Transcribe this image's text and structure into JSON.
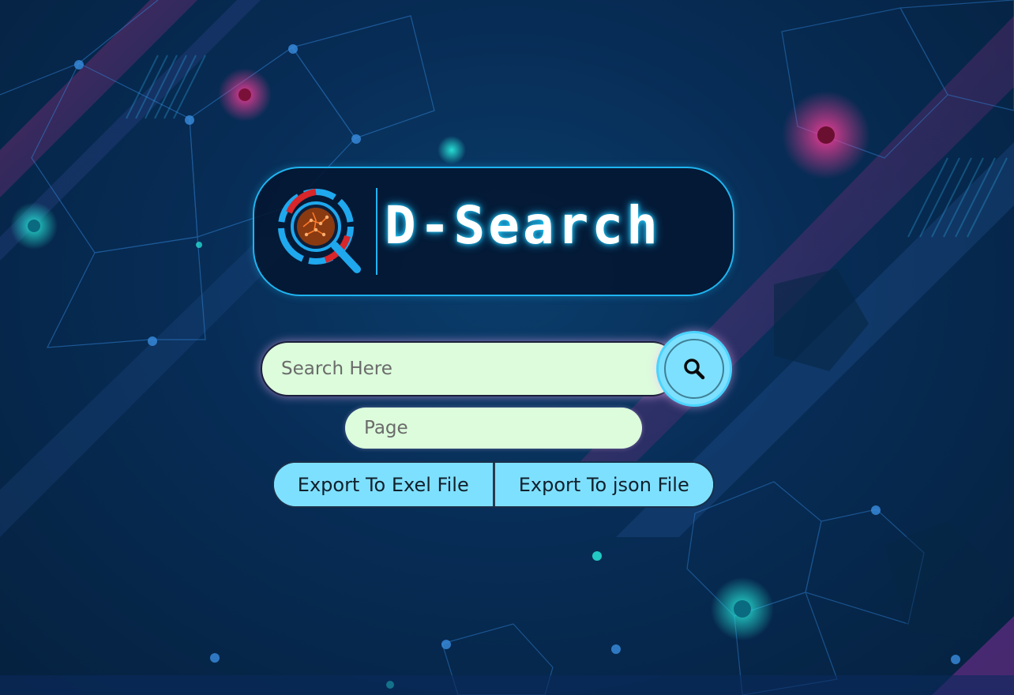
{
  "app": {
    "title": "D-Search"
  },
  "search": {
    "placeholder": "Search Here"
  },
  "page_field": {
    "placeholder": "Page"
  },
  "export": {
    "excel_label": "Export To Exel File",
    "json_label": "Export To json File"
  },
  "icons": {
    "logo": "magnifier-circuit-icon",
    "search_button": "search-icon"
  },
  "colors": {
    "accent": "#1fb4f0",
    "input_bg": "#dcfcdc",
    "button_bg": "#7ee0ff",
    "background": "#072c55"
  }
}
